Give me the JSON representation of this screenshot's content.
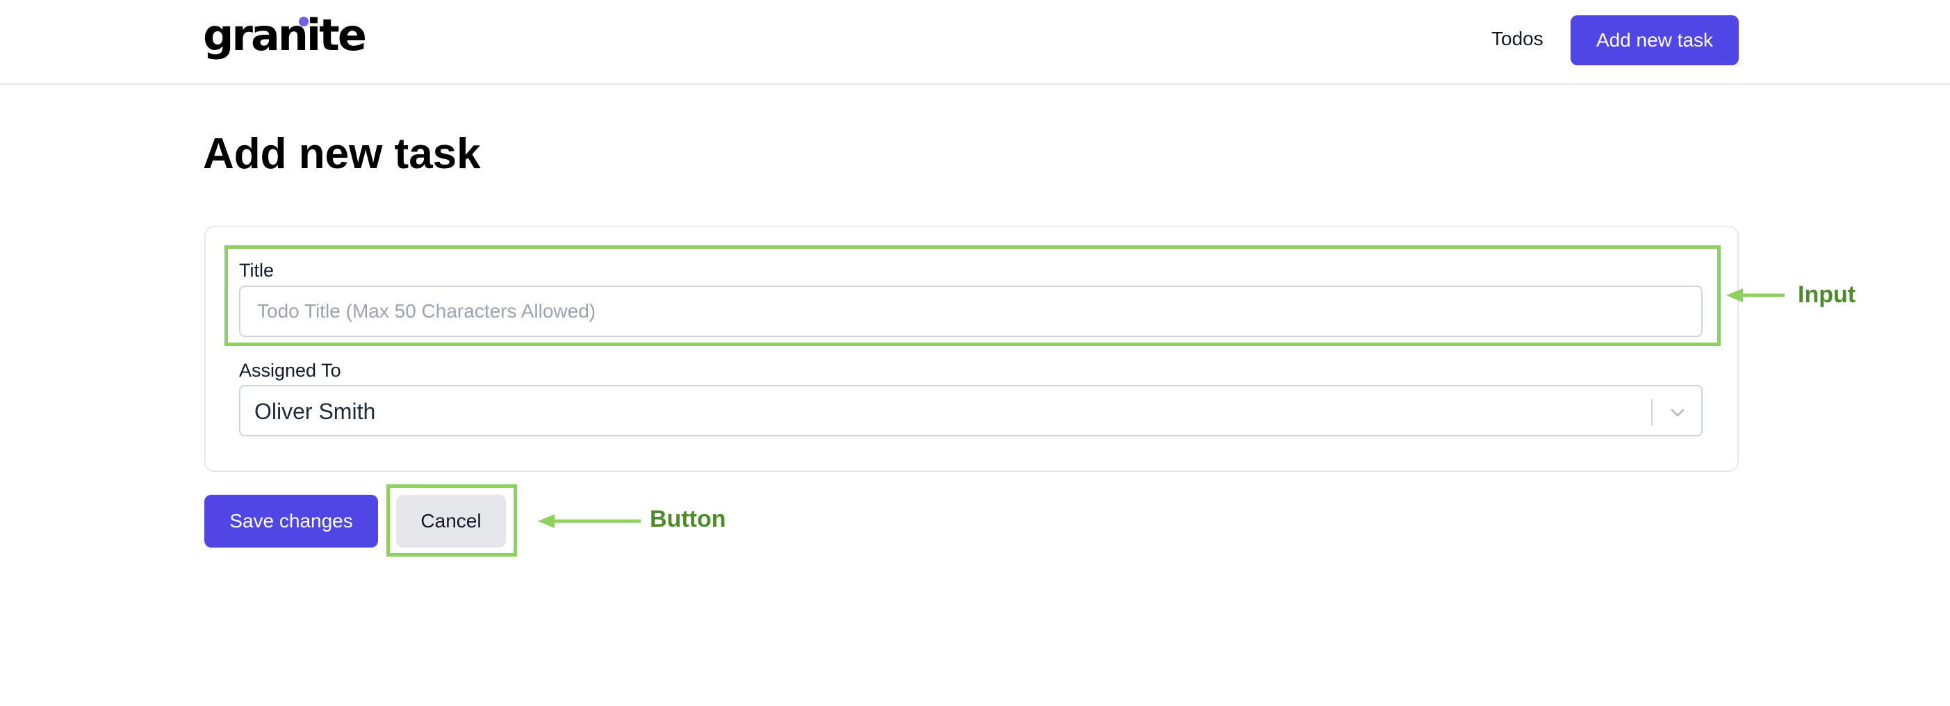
{
  "header": {
    "logo_text": "granite",
    "nav_link": "Todos",
    "add_button": "Add new task"
  },
  "page": {
    "title": "Add new task"
  },
  "form": {
    "title_label": "Title",
    "title_value": "",
    "title_placeholder": "Todo Title (Max 50 Characters Allowed)",
    "assigned_label": "Assigned To",
    "assigned_value": "Oliver Smith"
  },
  "actions": {
    "save": "Save changes",
    "cancel": "Cancel"
  },
  "annotations": {
    "input_label": "Input",
    "button_label": "Button"
  },
  "icons": {
    "select_indicator": "chevron-down-icon",
    "annotation_arrow": "arrow-left-icon"
  },
  "colors": {
    "primary": "#4f46e5",
    "highlight": "#8fd15e",
    "annotation_text": "#4f8a2a"
  }
}
